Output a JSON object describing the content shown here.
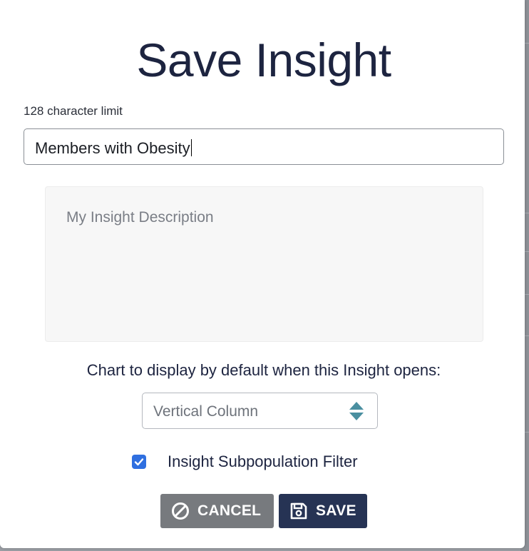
{
  "dialog": {
    "title": "Save Insight",
    "char_limit_note": "128 character limit"
  },
  "name_input": {
    "value": "Members with Obesity"
  },
  "description": {
    "placeholder": "My Insight Description"
  },
  "chart_select": {
    "label": "Chart to display by default when this Insight opens:",
    "value": "Vertical Column"
  },
  "subpopulation_filter": {
    "label": "Insight Subpopulation Filter",
    "checked": true
  },
  "buttons": {
    "cancel_label": "CANCEL",
    "save_label": "SAVE"
  },
  "icons": {
    "cancel": "ban-icon",
    "save": "floppy-disk-icon",
    "select": "sort-arrows-icon",
    "checkbox": "checkmark-icon"
  },
  "colors": {
    "title": "#1d2440",
    "cancel_button": "#777a7e",
    "save_button": "#263354",
    "checkbox": "#2f6fe0",
    "select_arrows": "#4a8fa0"
  }
}
